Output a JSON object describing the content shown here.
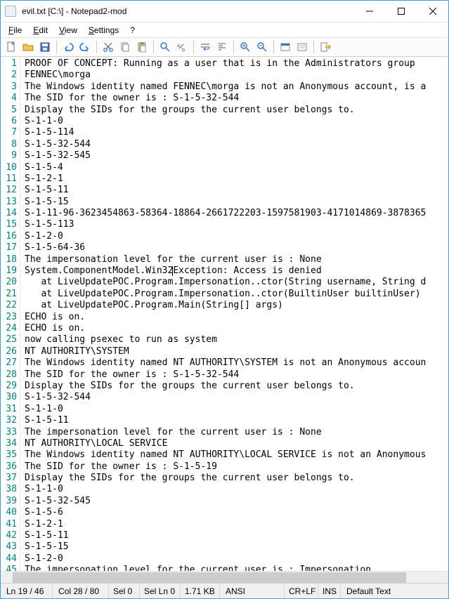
{
  "title": "evil.txt [C:\\] - Notepad2-mod",
  "menu": {
    "file": "File",
    "edit": "Edit",
    "view": "View",
    "settings": "Settings",
    "help": "?"
  },
  "lines": [
    "PROOF OF CONCEPT: Running as a user that is in the Administrators group",
    "FENNEC\\morga",
    "The Windows identity named FENNEC\\morga is not an Anonymous account, is a",
    "The SID for the owner is : S-1-5-32-544",
    "Display the SIDs for the groups the current user belongs to.",
    "S-1-1-0",
    "S-1-5-114",
    "S-1-5-32-544",
    "S-1-5-32-545",
    "S-1-5-4",
    "S-1-2-1",
    "S-1-5-11",
    "S-1-5-15",
    "S-1-11-96-3623454863-58364-18864-2661722203-1597581903-4171014869-3878365",
    "S-1-5-113",
    "S-1-2-0",
    "S-1-5-64-36",
    "The impersonation level for the current user is : None",
    "System.ComponentModel.Win32Exception: Access is denied",
    "   at LiveUpdatePOC.Program.Impersonation..ctor(String username, String d",
    "   at LiveUpdatePOC.Program.Impersonation..ctor(BuiltinUser builtinUser)",
    "   at LiveUpdatePOC.Program.Main(String[] args)",
    "ECHO is on.",
    "ECHO is on.",
    "now calling psexec to run as system",
    "NT AUTHORITY\\SYSTEM",
    "The Windows identity named NT AUTHORITY\\SYSTEM is not an Anonymous accoun",
    "The SID for the owner is : S-1-5-32-544",
    "Display the SIDs for the groups the current user belongs to.",
    "S-1-5-32-544",
    "S-1-1-0",
    "S-1-5-11",
    "The impersonation level for the current user is : None",
    "NT AUTHORITY\\LOCAL SERVICE",
    "The Windows identity named NT AUTHORITY\\LOCAL SERVICE is not an Anonymous",
    "The SID for the owner is : S-1-5-19",
    "Display the SIDs for the groups the current user belongs to.",
    "S-1-1-0",
    "S-1-5-32-545",
    "S-1-5-6",
    "S-1-2-1",
    "S-1-5-11",
    "S-1-5-15",
    "S-1-2-0",
    "The impersonation level for the current user is : Impersonation",
    ""
  ],
  "caret_line": 19,
  "status": {
    "pos": "Ln 19 / 46",
    "col": "Col 28 / 80",
    "sel": "Sel 0",
    "seln": "Sel Ln 0",
    "size": "1.71 KB",
    "enc": "ANSI",
    "eol": "CR+LF",
    "ovr": "INS",
    "lex": "Default Text"
  }
}
